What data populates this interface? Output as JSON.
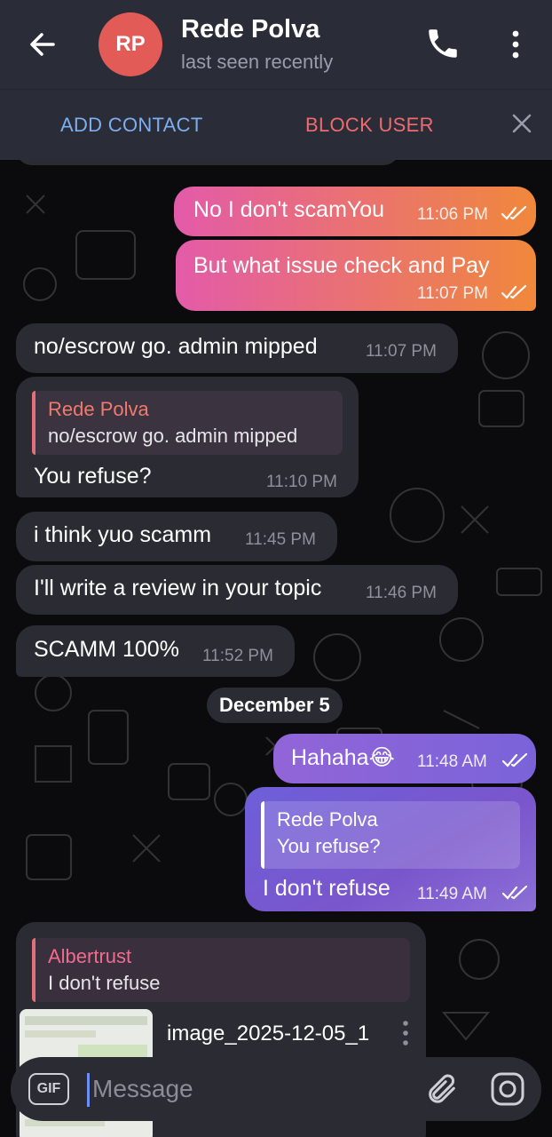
{
  "header": {
    "avatar_initials": "RP",
    "avatar_color": "#e25b57",
    "name": "Rede Polva",
    "status": "last seen recently",
    "back_icon": "arrow-left-icon",
    "call_icon": "phone-icon",
    "menu_icon": "more-vertical-icon"
  },
  "action_bar": {
    "add_contact": "ADD CONTACT",
    "block_user": "BLOCK USER",
    "close_icon": "close-icon"
  },
  "messages": [
    {
      "text": "No I don't scamYou",
      "time": "11:06 PM",
      "dir": "out",
      "read": true
    },
    {
      "text": "But what issue check and Pay",
      "time": "11:07 PM",
      "dir": "out",
      "read": true
    },
    {
      "text": "no/escrow go. admin mipped",
      "time": "11:07 PM",
      "dir": "in"
    },
    {
      "reply": {
        "name": "Rede Polva",
        "text": "no/escrow go. admin mipped"
      },
      "text": "You refuse?",
      "time": "11:10 PM",
      "dir": "in"
    },
    {
      "text": "i think yuo scamm",
      "time": "11:45 PM",
      "dir": "in"
    },
    {
      "text": "I'll write a review in your topic",
      "time": "11:46 PM",
      "dir": "in"
    },
    {
      "text": "SCAMM 100%",
      "time": "11:52 PM",
      "dir": "in"
    },
    {
      "text": "Hahaha😂",
      "time": "11:48 AM",
      "dir": "out",
      "read": true
    },
    {
      "reply": {
        "name": "Rede Polva",
        "text": "You refuse?"
      },
      "text": "I don't refuse",
      "time": "11:49 AM",
      "dir": "out",
      "read": true
    },
    {
      "reply": {
        "name": "Albertrust",
        "text": "I don't refuse"
      },
      "file_name": "image_2025-12-05_1",
      "dir": "in"
    }
  ],
  "date_separator": "December 5",
  "input": {
    "gif_label": "GIF",
    "placeholder": "Message",
    "attach_icon": "paperclip-icon",
    "camera_icon": "camera-icon"
  },
  "colors": {
    "header_bg": "#2a2c38",
    "incoming_bubble": "#2b2c33",
    "outgoing_gradient_start": "#e35ba9",
    "outgoing_gradient_end": "#f0883b",
    "outgoing_purple": "#8a64d8",
    "add_contact": "#7dafef",
    "block_user": "#ef6b70"
  }
}
